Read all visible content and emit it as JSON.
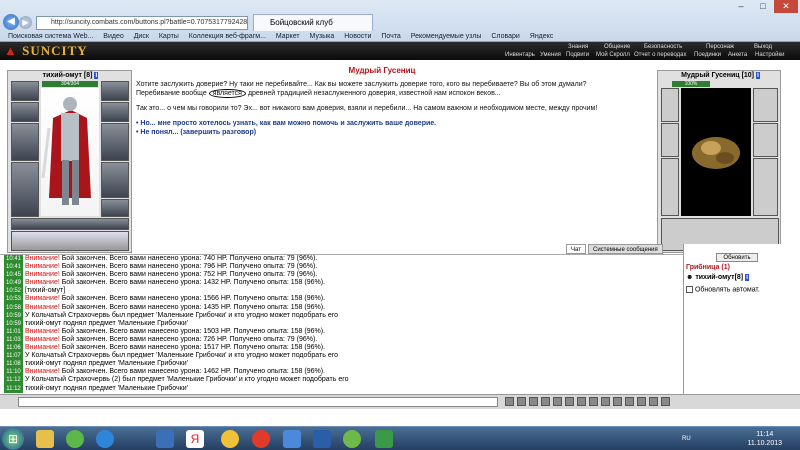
{
  "browser": {
    "url": "http://suncity.combats.com/buttons.pl?battle=0.7075317792428",
    "tab_title": "Бойцовский клуб",
    "favorites": [
      "Поисковая система Web...",
      "Видео",
      "Диск",
      "Карты",
      "Коллекция веб-фрагм...",
      "Маркет",
      "Музыка",
      "Новости",
      "Почта",
      "Рекомендуемые узлы",
      "Словари",
      "Яндекс"
    ]
  },
  "game": {
    "logo": "SUNCITY",
    "menu_top": [
      "Знания",
      "Общение",
      "Безопасность",
      "Персонаж",
      "Выход"
    ],
    "menu_bottom": [
      "Инвентарь",
      "Умения",
      "Подвиги",
      "Мой Скролл",
      "Отчет о переводах",
      "Поединки",
      "Анкета",
      "Настройки"
    ],
    "player": {
      "name": "тихий-омут",
      "level": "[8]",
      "hp": "304/304"
    },
    "monster": {
      "name": "Мудрый Гусениц",
      "level": "[10]",
      "hp": "100%"
    },
    "dialog": {
      "title": "Мудрый Гусениц",
      "text1": "Хотите заслужить доверие? Ну таки не перебивайте... Как вы можете заслужить доверие того, кого вы перебиваете? Вы об этом думали? Перебивание вообще",
      "circled": "является",
      "text1b": "древней традицией незаслуженного доверия, известной нам испокон веков...",
      "text2": "Так это... о чем мы говорили то? Эх... вот никакого вам доверия, взяли и перебили... На самом важном и необходимом месте, между прочим!",
      "options": [
        "• Но... мне просто хотелось узнать, как вам можно помочь и заслужить ваше доверие.",
        "• Не понял... (завершить разговор)"
      ]
    },
    "chat_tabs": [
      "Чат",
      "Системные сообщения"
    ],
    "chat": [
      {
        "t": "10:41",
        "p": "Внимание!",
        "m": " Бой закончен. Всего вами нанесено урона: 740 HP. Получено опыта: 79 (96%)."
      },
      {
        "t": "10:41",
        "p": "Внимание!",
        "m": " Бой закончен. Всего вами нанесено урона: 796 HP. Получено опыта: 79 (96%)."
      },
      {
        "t": "10:45",
        "p": "Внимание!",
        "m": " Бой закончен. Всего вами нанесено урона: 752 HP. Получено опыта: 79 (96%)."
      },
      {
        "t": "10:49",
        "p": "Внимание!",
        "m": " Бой закончен. Всего вами нанесено урона: 1432 HP. Получено опыта: 158 (96%)."
      },
      {
        "t": "10:52",
        "p": "",
        "m": "[тихий-омут]"
      },
      {
        "t": "10:53",
        "p": "Внимание!",
        "m": " Бой закончен. Всего вами нанесено урона: 1566 HP. Получено опыта: 158 (96%)."
      },
      {
        "t": "10:58",
        "p": "Внимание!",
        "m": " Бой закончен. Всего вами нанесено урона: 1435 HP. Получено опыта: 158 (96%)."
      },
      {
        "t": "10:59",
        "p": "",
        "m": "У Кольчатый Страхочервь был предмет 'Маленькие Грибочки' и кто угодно может подобрать его"
      },
      {
        "t": "10:59",
        "p": "",
        "m": "тихий-омут поднял предмет 'Маленькие Грибочки'"
      },
      {
        "t": "11:01",
        "p": "Внимание!",
        "m": " Бой закончен. Всего вами нанесено урона: 1503 HP. Получено опыта: 158 (96%)."
      },
      {
        "t": "11:03",
        "p": "Внимание!",
        "m": " Бой закончен. Всего вами нанесено урона: 726 HP. Получено опыта: 79 (96%)."
      },
      {
        "t": "11:06",
        "p": "Внимание!",
        "m": " Бой закончен. Всего вами нанесено урона: 1517 HP. Получено опыта: 158 (96%)."
      },
      {
        "t": "11:07",
        "p": "",
        "m": "У Кольчатый Страхочервь был предмет 'Маленькие Грибочки' и кто угодно может подобрать его"
      },
      {
        "t": "11:08",
        "p": "",
        "m": "тихий-омут поднял предмет 'Маленькие Грибочки'"
      },
      {
        "t": "11:10",
        "p": "Внимание!",
        "m": " Бой закончен. Всего вами нанесено урона: 1462 HP. Получено опыта: 158 (96%)."
      },
      {
        "t": "11:12",
        "p": "",
        "m": "У Кольчатый Страхочервь (2) был предмет 'Маленькие Грибочки' и кто угодно может подобрать его"
      },
      {
        "t": "11:12",
        "p": "",
        "m": "тихий-омут поднял предмет 'Маленькие Грибочки'"
      }
    ],
    "side": {
      "refresh": "Обновить",
      "location": "Грибница (1)",
      "player_entry": "тихий-омут[8]",
      "auto_refresh": "Обновлять автомат."
    }
  },
  "taskbar": {
    "lang": "RU",
    "time": "11:14",
    "date": "11.10.2013"
  },
  "colors": {
    "warn": "#d21414",
    "title": "#b3141b",
    "option": "#1a3b8c"
  }
}
